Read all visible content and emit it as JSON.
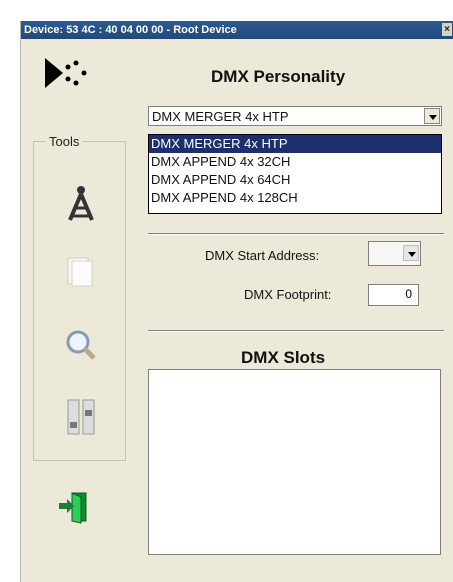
{
  "window": {
    "title": "Device: 53 4C : 40 04 00 00 - Root Device",
    "close_label": "×"
  },
  "personality": {
    "heading": "DMX Personality",
    "selected": "DMX MERGER 4x HTP",
    "options": [
      "DMX MERGER 4x HTP",
      "DMX APPEND 4x  32CH",
      "DMX APPEND 4x  64CH",
      "DMX APPEND 4x 128CH"
    ]
  },
  "tools": {
    "label": "Tools",
    "icons": [
      "antenna-tower-icon",
      "pages-icon",
      "magnifier-icon",
      "faders-icon"
    ]
  },
  "start_address": {
    "label": "DMX Start Address:",
    "value": ""
  },
  "footprint": {
    "label": "DMX Footprint:",
    "value": "0"
  },
  "slots": {
    "heading": "DMX Slots"
  },
  "exit": {
    "icon": "exit-door-icon"
  },
  "colors": {
    "titlebar": "#2c5a93",
    "panel": "#ece9d8",
    "selection": "#1d2f6d"
  }
}
